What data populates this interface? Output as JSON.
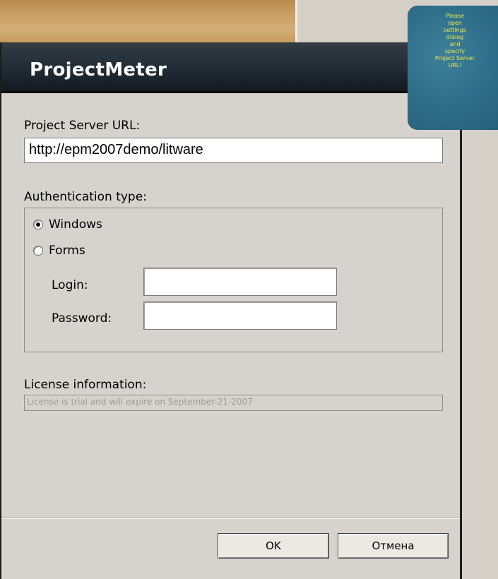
{
  "window": {
    "title": "ProjectMeter"
  },
  "server": {
    "label": "Project Server URL:",
    "url": "http://epm2007demo/litware"
  },
  "auth": {
    "label": "Authentication type:",
    "options": [
      {
        "label": "Windows",
        "selected": true
      },
      {
        "label": "Forms",
        "selected": false
      }
    ],
    "login_label": "Login:",
    "login_value": "",
    "password_label": "Password:",
    "password_value": ""
  },
  "license": {
    "label": "License information:",
    "text": "License is trial and will expire on September-21-2007"
  },
  "buttons": {
    "ok": "OK",
    "cancel": "Отмена"
  },
  "note": {
    "text": "Please\nopen\nsettings\ndialog\nand\nspecify\nProject Server\nURL!"
  }
}
